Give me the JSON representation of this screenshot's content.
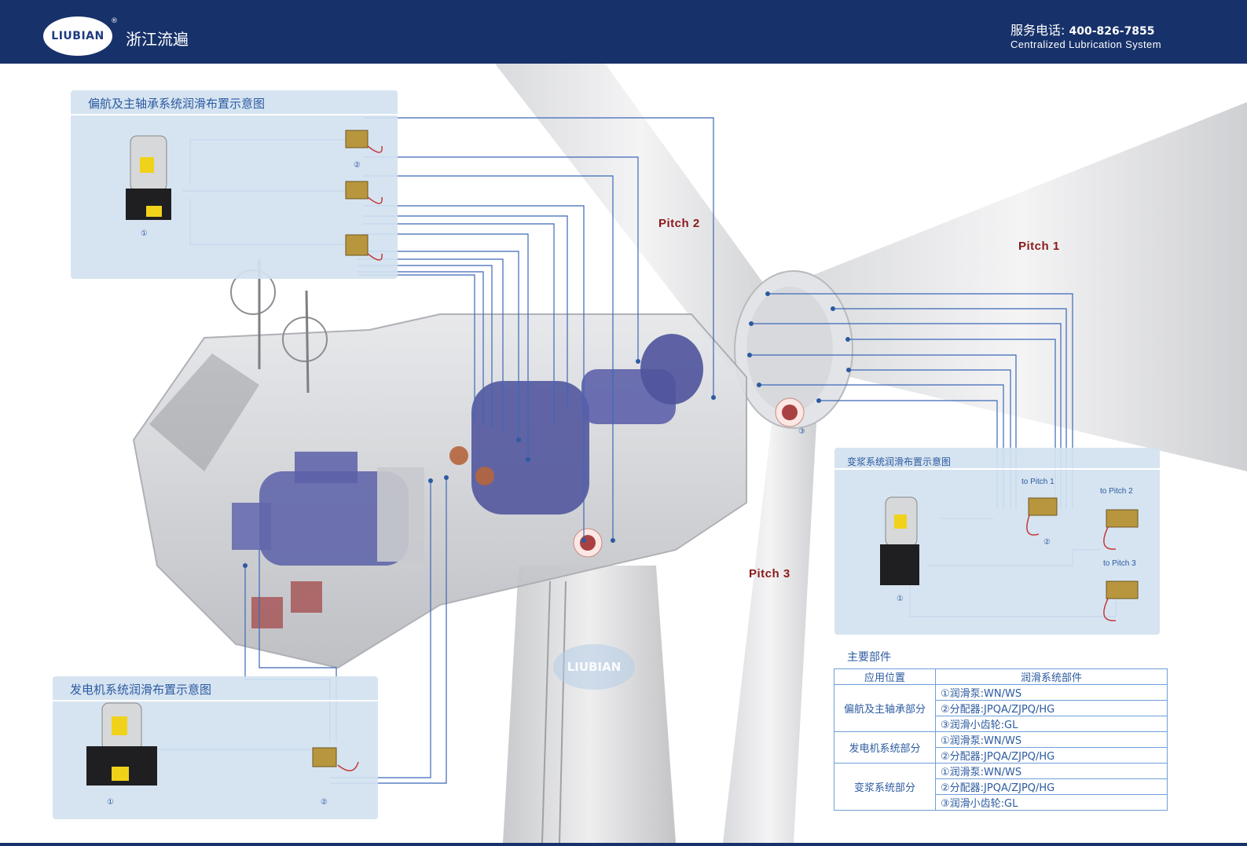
{
  "header": {
    "logo_text": "LIUBIAN",
    "registered": "®",
    "company": "浙江流遍",
    "hotline_label": "服务电话:",
    "hotline_number": "400-826-7855",
    "subtitle": "Centralized Lubrication System"
  },
  "panels": {
    "yaw": {
      "title": "偏航及主轴承系统润滑布置示意图",
      "pump_num": "①",
      "dist_num": "②"
    },
    "pitch": {
      "title": "变浆系统润滑布置示意图",
      "pump_num": "①",
      "dist_num": "②",
      "to1": "to Pitch 1",
      "to2": "to Pitch 2",
      "to3": "to Pitch 3"
    },
    "generator": {
      "title": "发电机系统润滑布置示意图",
      "pump_num": "①",
      "dist_num": "②"
    }
  },
  "labels": {
    "pitch1": "Pitch 1",
    "pitch2": "Pitch 2",
    "pitch3": "Pitch 3",
    "gear_num": "③",
    "watermark": "LIUBIAN"
  },
  "parts_table": {
    "title": "主要部件",
    "col1": "应用位置",
    "col2": "润滑系统部件",
    "groups": [
      {
        "location": "偏航及主轴承部分",
        "items": [
          "①润滑泵:WN/WS",
          "②分配器:JPQA/ZJPQ/HG",
          "③润滑小齿轮:GL"
        ]
      },
      {
        "location": "发电机系统部分",
        "items": [
          "①润滑泵:WN/WS",
          "②分配器:JPQA/ZJPQ/HG"
        ]
      },
      {
        "location": "变浆系统部分",
        "items": [
          "①润滑泵:WN/WS",
          "②分配器:JPQA/ZJPQ/HG",
          "③润滑小齿轮:GL"
        ]
      }
    ]
  },
  "colors": {
    "header_bg": "#17316a",
    "panel_bg": "#d3e2f0",
    "line": "#3b68b8",
    "pitch_text": "#8b1a1a",
    "machinery": "#5a5fa8"
  }
}
